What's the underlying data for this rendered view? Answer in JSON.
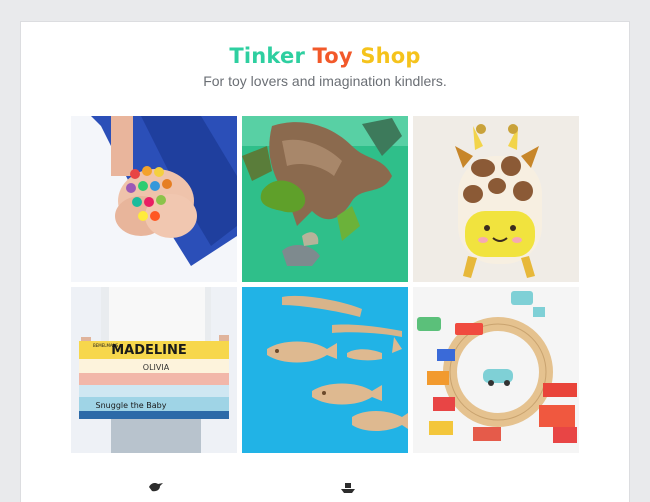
{
  "shop": {
    "title_words": [
      "Tinker",
      "Toy",
      "Shop"
    ],
    "tagline": "For toy lovers and imagination kindlers.",
    "brand_colors": [
      "#2ecfa0",
      "#f2592a",
      "#f5c31c"
    ]
  },
  "gallery": {
    "books": {
      "book1": "MADELINE",
      "book2": "OLIVIA",
      "book3": "Snuggle the Baby",
      "book4": "BEMELMANS"
    }
  },
  "icons": [
    "bird-icon",
    "boat-icon"
  ]
}
